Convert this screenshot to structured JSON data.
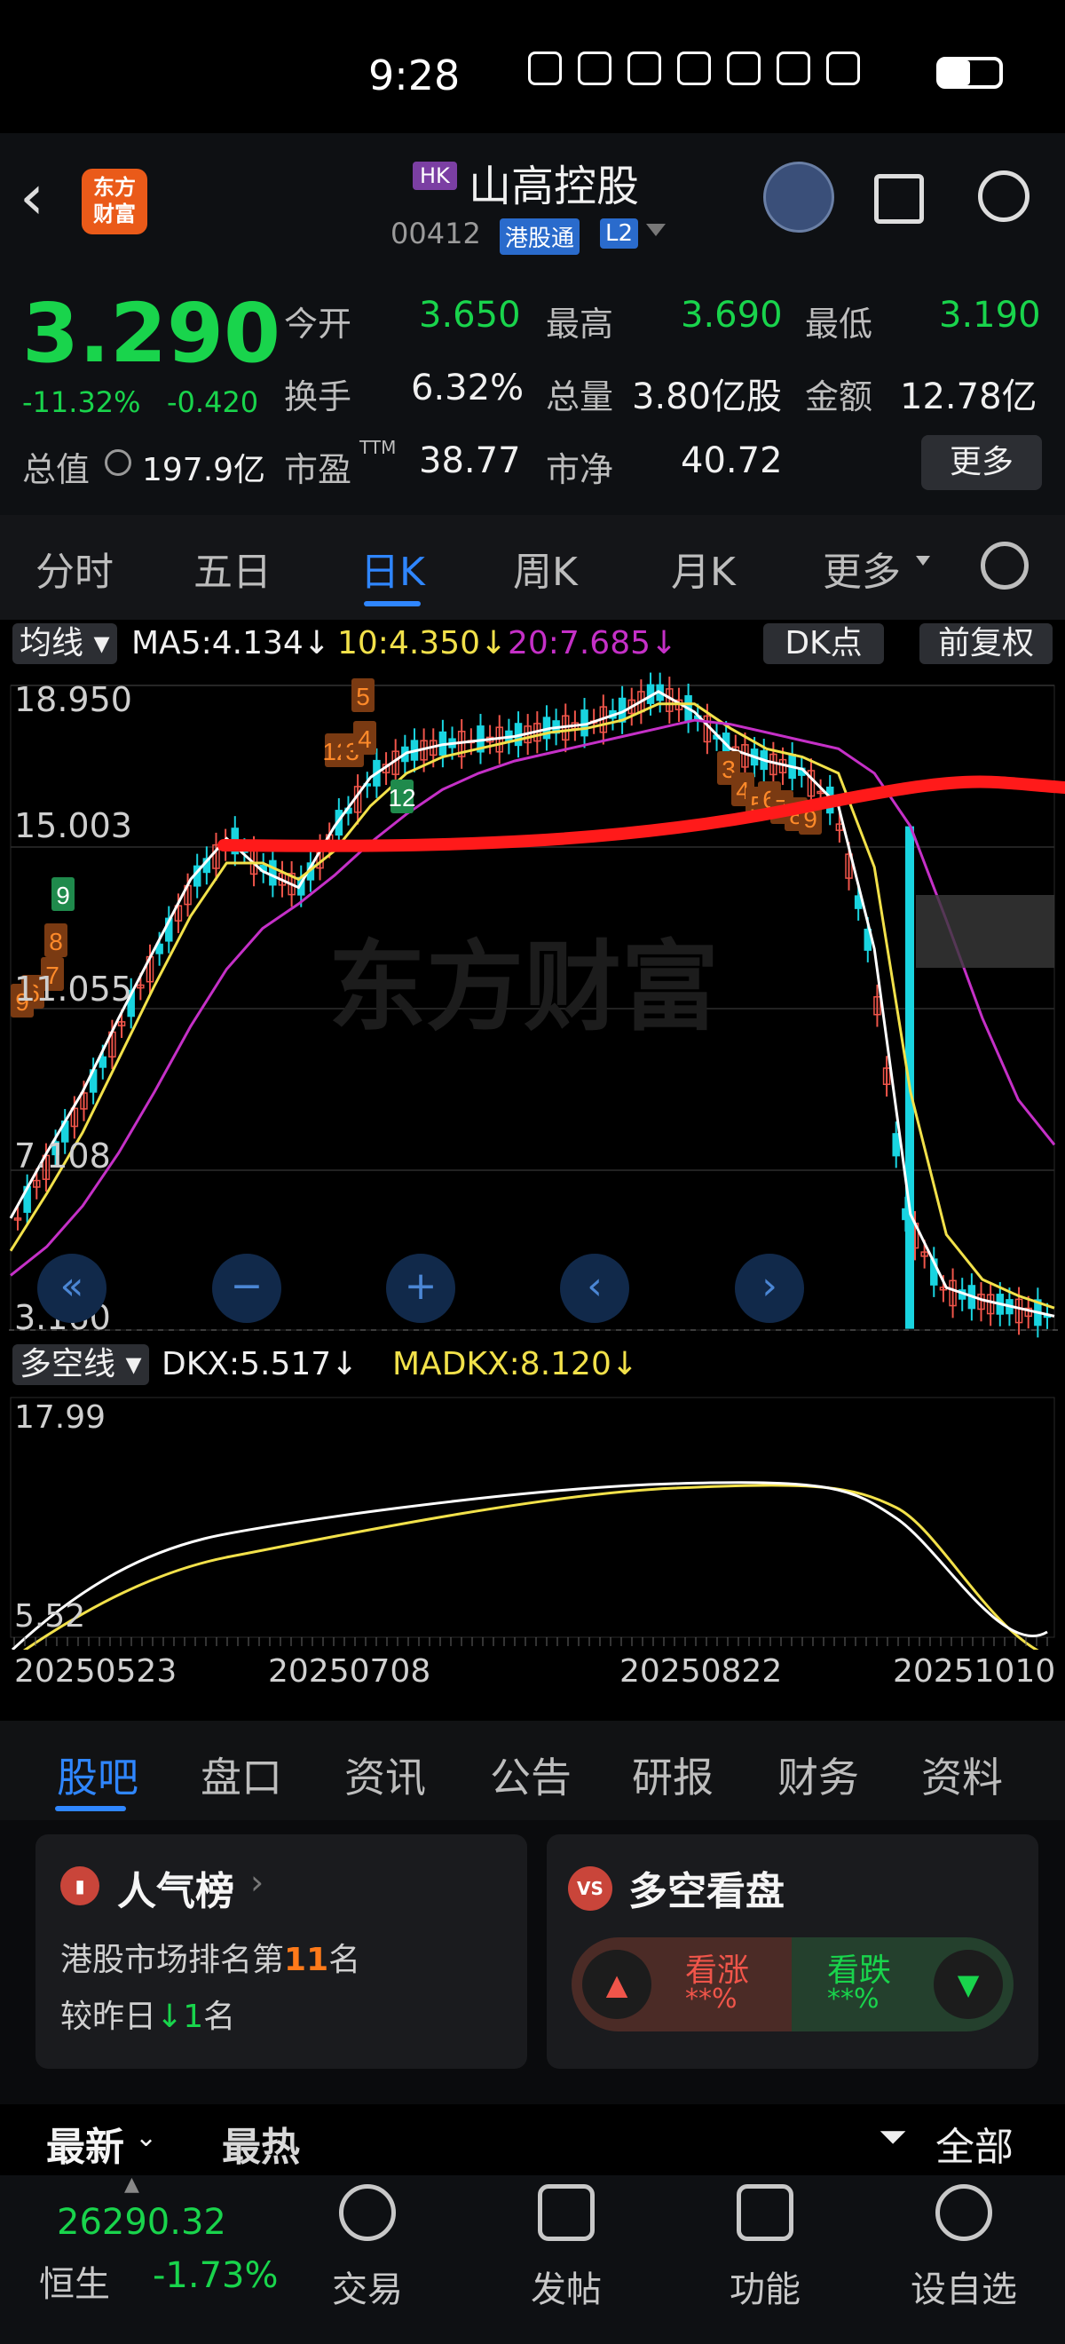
{
  "status_bar": {
    "time": "9:28"
  },
  "header": {
    "market_tag": "HK",
    "name": "山高控股",
    "code": "00412",
    "connect_tag": "港股通",
    "level_tag": "L2",
    "logo_text": "东方财富"
  },
  "quote": {
    "price": "3.290",
    "change_pct": "-11.32%",
    "change": "-0.420",
    "open_label": "今开",
    "open": "3.650",
    "high_label": "最高",
    "high": "3.690",
    "low_label": "最低",
    "low": "3.190",
    "turnover_label": "换手",
    "turnover": "6.32%",
    "volume_label": "总量",
    "volume": "3.80亿股",
    "amount_label": "金额",
    "amount": "12.78亿",
    "mktcap_label": "总值",
    "mktcap": "197.9亿",
    "pe_label": "市盈",
    "pe_sup": "TTM",
    "pe": "38.77",
    "pb_label": "市净",
    "pb": "40.72",
    "more_label": "更多"
  },
  "tabs": [
    "分时",
    "五日",
    "日K",
    "周K",
    "月K",
    "更多"
  ],
  "active_tab": "日K",
  "main_chart": {
    "indicator_label": "均线",
    "ma5": "MA5:4.134↓",
    "ma10": "10:4.350↓",
    "ma20": "20:7.685↓",
    "dk_label": "DK点",
    "adjust_label": "前复权",
    "y_labels": [
      "18.950",
      "15.003",
      "11.055",
      "7.108",
      "3.160"
    ],
    "watermark": "东方财富",
    "colors": {
      "ma5": "#ffffff",
      "ma10": "#f2e14a",
      "ma20": "#c530c7",
      "up": "#f0554a",
      "down": "#19d4e0",
      "trend": "#ff1a1a"
    },
    "dk_markers_visible": [
      "9",
      "5",
      "12",
      "3",
      "4",
      "8",
      "7",
      "6",
      "9",
      "12",
      "3",
      "4",
      "5",
      "6",
      "7",
      "8",
      "9"
    ]
  },
  "sub_chart": {
    "indicator_label": "多空线",
    "dkx": "DKX:5.517↓",
    "madkx": "MADKX:8.120↓",
    "y_labels": [
      "17.99",
      "5.52"
    ]
  },
  "chart_data": {
    "type": "line",
    "title": "",
    "x_labels": [
      "20250523",
      "20250708",
      "20250822",
      "20251010"
    ],
    "y_range": [
      3.16,
      18.95
    ],
    "series": [
      {
        "name": "MA5",
        "values": [
          5.9,
          7.5,
          9.0,
          10.8,
          12.5,
          14.2,
          15.2,
          14.4,
          14.0,
          15.5,
          16.7,
          17.3,
          17.5,
          17.6,
          17.7,
          17.9,
          18.0,
          18.3,
          18.8,
          18.3,
          17.4,
          17.1,
          16.9,
          16.0,
          12.5,
          6.0,
          4.2,
          3.9,
          3.7,
          3.5
        ]
      },
      {
        "name": "10",
        "values": [
          5.1,
          6.5,
          8.0,
          9.8,
          11.6,
          13.3,
          14.6,
          14.6,
          14.2,
          14.9,
          16.0,
          16.8,
          17.2,
          17.4,
          17.6,
          17.8,
          17.9,
          18.1,
          18.5,
          18.5,
          17.9,
          17.4,
          17.2,
          16.8,
          14.5,
          9.0,
          5.5,
          4.4,
          4.0,
          3.7
        ]
      },
      {
        "name": "20",
        "values": [
          4.5,
          5.2,
          6.2,
          7.5,
          9.0,
          10.6,
          12.0,
          13.0,
          13.6,
          14.3,
          15.1,
          15.8,
          16.4,
          16.8,
          17.1,
          17.3,
          17.5,
          17.7,
          17.9,
          18.1,
          18.0,
          17.8,
          17.6,
          17.4,
          16.8,
          15.5,
          13.2,
          10.8,
          8.8,
          7.7
        ]
      }
    ]
  },
  "sub_tabs": [
    "股吧",
    "盘口",
    "资讯",
    "公告",
    "研报",
    "财务",
    "资料"
  ],
  "active_sub_tab": "股吧",
  "popularity": {
    "title": "人气榜",
    "line1_prefix": "港股市场排名第",
    "rank": "11",
    "line1_suffix": "名",
    "line2_prefix": "较昨日",
    "delta": "1",
    "line2_suffix": "名"
  },
  "sentiment": {
    "title": "多空看盘",
    "bull_label": "看涨",
    "bull_value": "**%",
    "bear_label": "看跌",
    "bear_value": "**%"
  },
  "feed_filter": {
    "latest": "最新",
    "hottest": "最热",
    "all": "全部"
  },
  "bottom_bar": {
    "index_value": "26290.32",
    "index_name": "恒生",
    "index_change": "-1.73%",
    "items": [
      "交易",
      "发帖",
      "功能",
      "设自选"
    ]
  }
}
